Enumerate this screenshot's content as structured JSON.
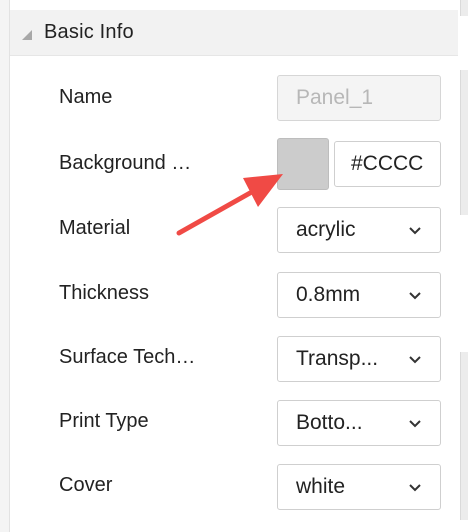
{
  "section": {
    "title": "Basic Info"
  },
  "fields": {
    "name": {
      "label": "Name",
      "placeholder": "Panel_1"
    },
    "background": {
      "label": "Background …",
      "color": "#cccccc",
      "hex_value": "#CCCC"
    },
    "material": {
      "label": "Material",
      "value": "acrylic"
    },
    "thickness": {
      "label": "Thickness",
      "value": "0.8mm"
    },
    "surface": {
      "label": "Surface Tech…",
      "value": "Transp..."
    },
    "print": {
      "label": "Print Type",
      "value": "Botto..."
    },
    "cover": {
      "label": "Cover",
      "value": "white"
    }
  },
  "annotation": {
    "arrow_color": "#f04a45"
  }
}
